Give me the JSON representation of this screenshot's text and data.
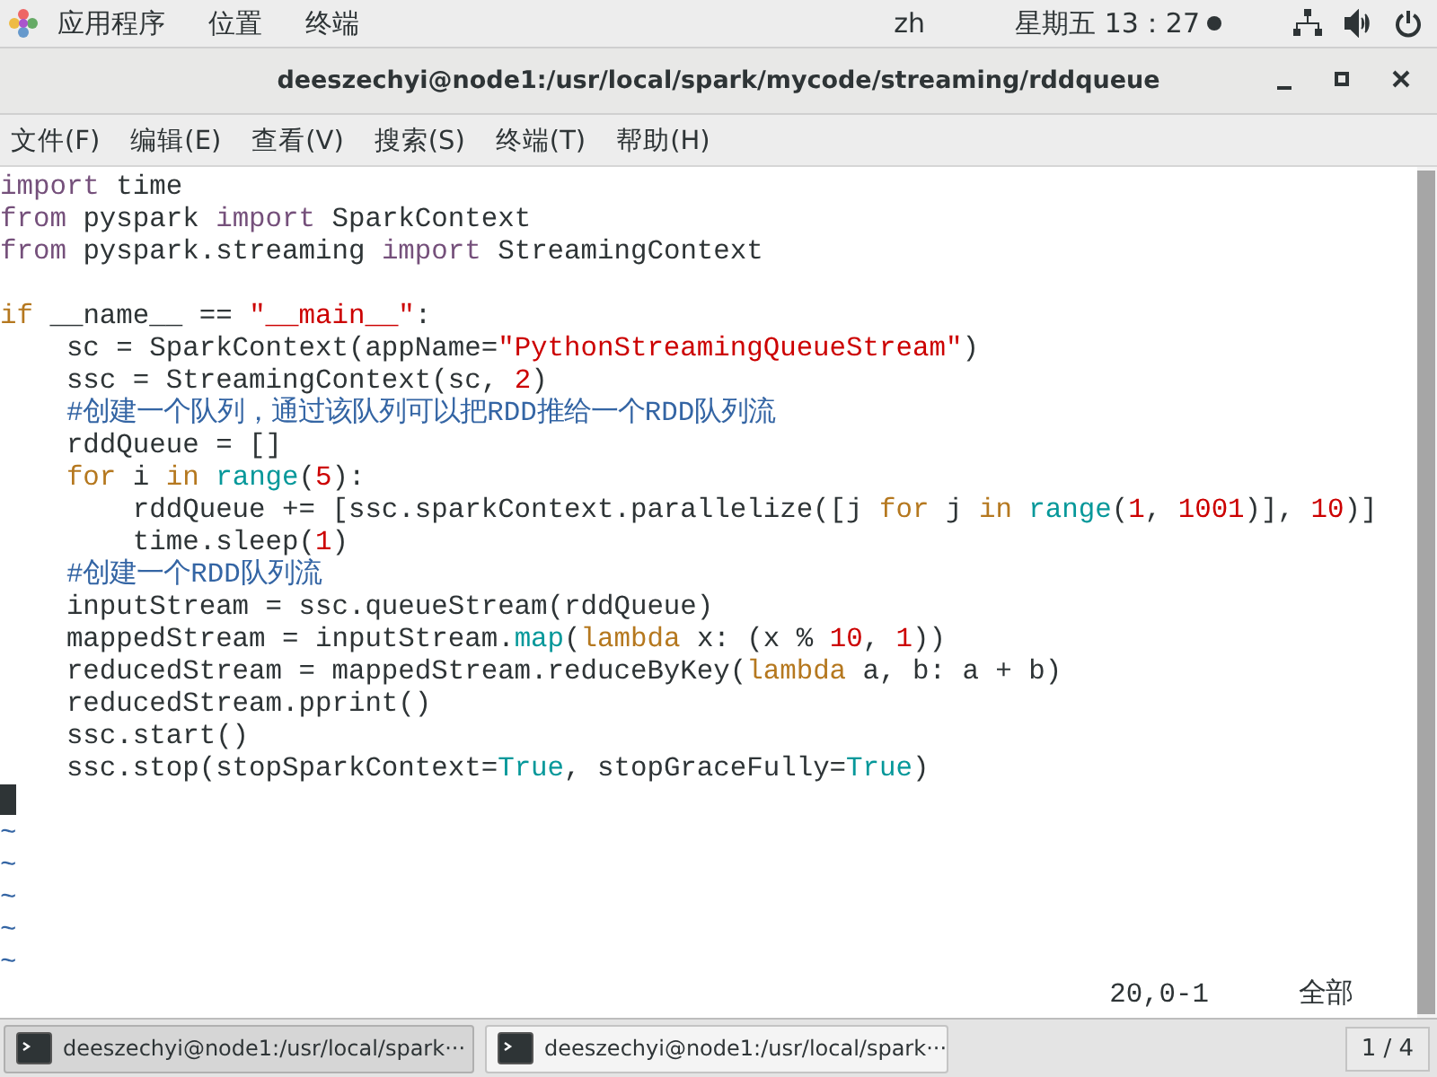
{
  "top_bar": {
    "menus": [
      "应用程序",
      "位置",
      "终端"
    ],
    "input_method": "zh",
    "clock": "星期五 13：27"
  },
  "window": {
    "title": "deeszechyi@node1:/usr/local/spark/mycode/streaming/rddqueue"
  },
  "menu_bar": [
    "文件(F)",
    "编辑(E)",
    "查看(V)",
    "搜索(S)",
    "终端(T)",
    "帮助(H)"
  ],
  "editor": {
    "lines": [
      {
        "kind": "code",
        "tokens": [
          {
            "kind": "keyword",
            "text": "import"
          },
          {
            "kind": "plain",
            "text": " time"
          }
        ]
      },
      {
        "kind": "code",
        "tokens": [
          {
            "kind": "keyword",
            "text": "from"
          },
          {
            "kind": "plain",
            "text": " pyspark "
          },
          {
            "kind": "keyword",
            "text": "import"
          },
          {
            "kind": "plain",
            "text": " SparkContext"
          }
        ]
      },
      {
        "kind": "code",
        "tokens": [
          {
            "kind": "keyword",
            "text": "from"
          },
          {
            "kind": "plain",
            "text": " pyspark.streaming "
          },
          {
            "kind": "keyword",
            "text": "import"
          },
          {
            "kind": "plain",
            "text": " StreamingContext"
          }
        ]
      },
      {
        "kind": "blank"
      },
      {
        "kind": "code",
        "tokens": [
          {
            "kind": "control",
            "text": "if"
          },
          {
            "kind": "plain",
            "text": " __name__ == "
          },
          {
            "kind": "string",
            "text": "\"__main__\""
          },
          {
            "kind": "plain",
            "text": ":"
          }
        ]
      },
      {
        "kind": "code",
        "tokens": [
          {
            "kind": "plain",
            "text": "    sc = SparkContext(appName="
          },
          {
            "kind": "string",
            "text": "\"PythonStreamingQueueStream\""
          },
          {
            "kind": "plain",
            "text": ")"
          }
        ]
      },
      {
        "kind": "code",
        "tokens": [
          {
            "kind": "plain",
            "text": "    ssc = StreamingContext(sc, "
          },
          {
            "kind": "number",
            "text": "2"
          },
          {
            "kind": "plain",
            "text": ")"
          }
        ]
      },
      {
        "kind": "code",
        "tokens": [
          {
            "kind": "comment",
            "text": "    #创建一个队列，通过该队列可以把RDD推给一个RDD队列流"
          }
        ]
      },
      {
        "kind": "code",
        "tokens": [
          {
            "kind": "plain",
            "text": "    rddQueue = []"
          }
        ]
      },
      {
        "kind": "code",
        "tokens": [
          {
            "kind": "control",
            "text": "    for"
          },
          {
            "kind": "plain",
            "text": " i "
          },
          {
            "kind": "control",
            "text": "in "
          },
          {
            "kind": "builtin",
            "text": "range"
          },
          {
            "kind": "plain",
            "text": "("
          },
          {
            "kind": "number",
            "text": "5"
          },
          {
            "kind": "plain",
            "text": "):"
          }
        ]
      },
      {
        "kind": "code",
        "tokens": [
          {
            "kind": "plain",
            "text": "        rddQueue += [ssc.sparkContext.parallelize([j "
          },
          {
            "kind": "control",
            "text": "for"
          },
          {
            "kind": "plain",
            "text": " j "
          },
          {
            "kind": "control",
            "text": "in "
          },
          {
            "kind": "builtin",
            "text": "range"
          },
          {
            "kind": "plain",
            "text": "("
          },
          {
            "kind": "number",
            "text": "1"
          },
          {
            "kind": "plain",
            "text": ", "
          },
          {
            "kind": "number",
            "text": "1001"
          },
          {
            "kind": "plain",
            "text": ")], "
          },
          {
            "kind": "number",
            "text": "10"
          },
          {
            "kind": "plain",
            "text": ")]"
          }
        ]
      },
      {
        "kind": "code",
        "tokens": [
          {
            "kind": "plain",
            "text": "        time.sleep("
          },
          {
            "kind": "number",
            "text": "1"
          },
          {
            "kind": "plain",
            "text": ")"
          }
        ]
      },
      {
        "kind": "code",
        "tokens": [
          {
            "kind": "comment",
            "text": "    #创建一个RDD队列流"
          }
        ]
      },
      {
        "kind": "code",
        "tokens": [
          {
            "kind": "plain",
            "text": "    inputStream = ssc.queueStream(rddQueue)"
          }
        ]
      },
      {
        "kind": "code",
        "tokens": [
          {
            "kind": "plain",
            "text": "    mappedStream = inputStream."
          },
          {
            "kind": "builtin",
            "text": "map"
          },
          {
            "kind": "plain",
            "text": "("
          },
          {
            "kind": "control",
            "text": "lambda"
          },
          {
            "kind": "plain",
            "text": " x: (x % "
          },
          {
            "kind": "number",
            "text": "10"
          },
          {
            "kind": "plain",
            "text": ", "
          },
          {
            "kind": "number",
            "text": "1"
          },
          {
            "kind": "plain",
            "text": "))"
          }
        ]
      },
      {
        "kind": "code",
        "tokens": [
          {
            "kind": "plain",
            "text": "    reducedStream = mappedStream.reduceByKey("
          },
          {
            "kind": "control",
            "text": "lambda"
          },
          {
            "kind": "plain",
            "text": " a, b: a + b)"
          }
        ]
      },
      {
        "kind": "code",
        "tokens": [
          {
            "kind": "plain",
            "text": "    reducedStream.pprint()"
          }
        ]
      },
      {
        "kind": "code",
        "tokens": [
          {
            "kind": "plain",
            "text": "    ssc.start()"
          }
        ]
      },
      {
        "kind": "code",
        "tokens": [
          {
            "kind": "plain",
            "text": "    ssc.stop(stopSparkContext="
          },
          {
            "kind": "builtin",
            "text": "True"
          },
          {
            "kind": "plain",
            "text": ", stopGraceFully="
          },
          {
            "kind": "builtin",
            "text": "True"
          },
          {
            "kind": "plain",
            "text": ")"
          }
        ]
      },
      {
        "kind": "cursor"
      }
    ],
    "empty_line_markers": [
      "~",
      "~",
      "~",
      "~",
      "~"
    ],
    "status": {
      "position": "20,0-1",
      "scroll": "全部"
    }
  },
  "taskbar": {
    "windows": [
      {
        "label": "deeszechyi@node1:/usr/local/spark···",
        "selected": true
      },
      {
        "label": "deeszechyi@node1:/usr/local/spark···",
        "selected": false
      }
    ],
    "workspace": "1 / 4"
  }
}
